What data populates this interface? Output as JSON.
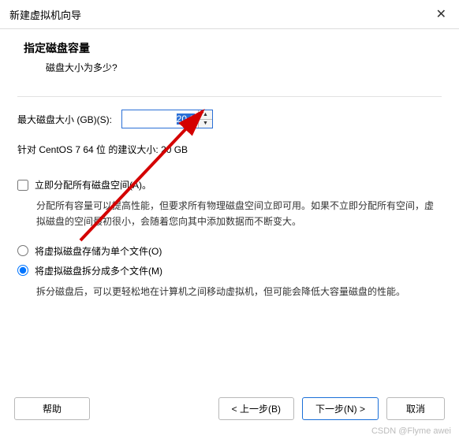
{
  "window": {
    "title": "新建虚拟机向导"
  },
  "header": {
    "title": "指定磁盘容量",
    "subtitle": "磁盘大小为多少?"
  },
  "disk": {
    "max_label": "最大磁盘大小 (GB)(S):",
    "max_value": "20.0",
    "recommend_text": "针对 CentOS 7 64 位 的建议大小: 20 GB"
  },
  "allocate": {
    "label": "立即分配所有磁盘空间(A)。",
    "desc": "分配所有容量可以提高性能，但要求所有物理磁盘空间立即可用。如果不立即分配所有空间，虚拟磁盘的空间最初很小，会随着您向其中添加数据而不断变大。"
  },
  "split": {
    "single_label": "将虚拟磁盘存储为单个文件(O)",
    "multi_label": "将虚拟磁盘拆分成多个文件(M)",
    "multi_desc": "拆分磁盘后，可以更轻松地在计算机之间移动虚拟机，但可能会降低大容量磁盘的性能。"
  },
  "buttons": {
    "help": "帮助",
    "back": "< 上一步(B)",
    "next": "下一步(N) >",
    "cancel": "取消"
  },
  "watermark": "CSDN @Flyme awei"
}
